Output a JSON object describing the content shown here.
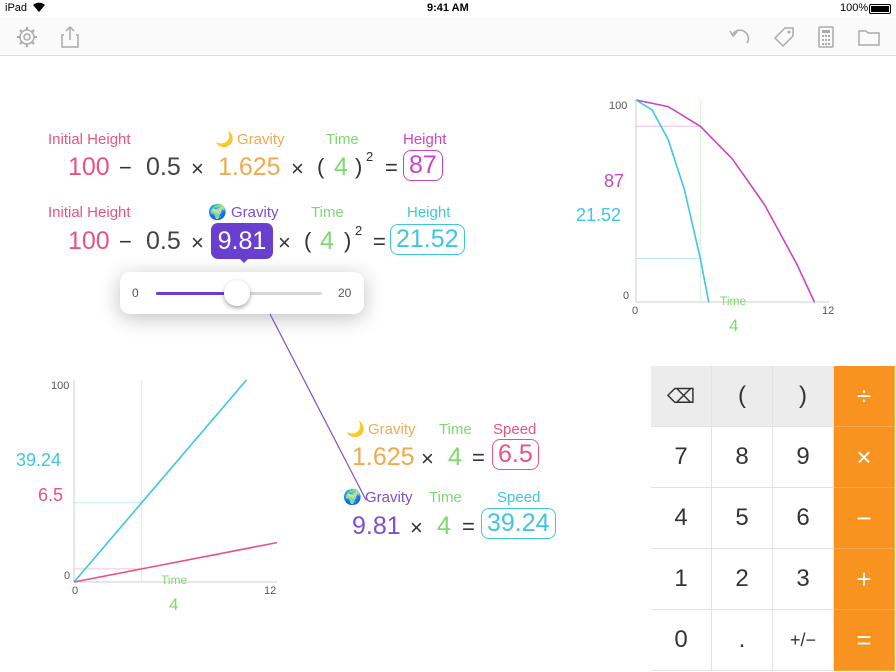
{
  "status": {
    "device": "iPad",
    "time": "9:41 AM",
    "battery": "100%"
  },
  "toolbar": {
    "left_icons": [
      "gear-icon",
      "share-icon"
    ],
    "right_icons": [
      "undo-icon",
      "tag-icon",
      "calculator-icon",
      "folder-icon"
    ]
  },
  "eq1": {
    "initial_height_label": "Initial Height",
    "initial_height": "100",
    "minus": "−",
    "half": "0.5",
    "times": "×",
    "gravity_label": "Gravity",
    "gravity_icon": "🌙",
    "gravity": "1.625",
    "time_label": "Time",
    "time": "4",
    "open_paren": "(",
    "close_paren": ")",
    "exponent": "2",
    "equals": "=",
    "height_label": "Height",
    "height": "87"
  },
  "eq2": {
    "initial_height_label": "Initial Height",
    "initial_height": "100",
    "minus": "−",
    "half": "0.5",
    "times": "×",
    "gravity_label": "Gravity",
    "gravity_icon": "🌍",
    "gravity": "9.81",
    "time_label": "Time",
    "time": "4",
    "open_paren": "(",
    "close_paren": ")",
    "exponent": "2",
    "equals": "=",
    "height_label": "Height",
    "height": "21.52"
  },
  "slider": {
    "min_label": "0",
    "max_label": "20",
    "value": 9.81,
    "min": 0,
    "max": 20
  },
  "eq3": {
    "gravity_label": "Gravity",
    "gravity_icon": "🌙",
    "gravity": "1.625",
    "times": "×",
    "time_label": "Time",
    "time": "4",
    "equals": "=",
    "speed_label": "Speed",
    "speed": "6.5"
  },
  "eq4": {
    "gravity_label": "Gravity",
    "gravity_icon": "🌍",
    "gravity": "9.81",
    "times": "×",
    "time_label": "Time",
    "time": "4",
    "equals": "=",
    "speed_label": "Speed",
    "speed": "39.24"
  },
  "chart_height": {
    "y_top_tick": "100",
    "y_zero_tick": "0",
    "x_zero_tick": "0",
    "x_max_tick": "12",
    "value_label_1": "87",
    "value_label_2": "21.52",
    "x_label": "Time",
    "x_value": "4"
  },
  "chart_speed": {
    "y_top_tick": "100",
    "y_zero_tick": "0",
    "x_zero_tick": "0",
    "x_max_tick": "12",
    "value_label_1": "39.24",
    "value_label_2": "6.5",
    "x_label": "Time",
    "x_value": "4"
  },
  "chart_data": [
    {
      "type": "line",
      "xlabel": "Time",
      "x_marker": 4,
      "xlim": [
        0,
        12
      ],
      "ylim": [
        0,
        100
      ],
      "series": [
        {
          "color": "#cc44c4",
          "values": [
            [
              0,
              100
            ],
            [
              2,
              96.75
            ],
            [
              4,
              87
            ],
            [
              6,
              70.75
            ],
            [
              8,
              48
            ],
            [
              10,
              18.75
            ],
            [
              11.09,
              0
            ]
          ]
        },
        {
          "color": "#3fc6e0",
          "values": [
            [
              0,
              100
            ],
            [
              1,
              95.1
            ],
            [
              2,
              80.38
            ],
            [
              3,
              55.86
            ],
            [
              4,
              21.52
            ],
            [
              4.52,
              0
            ]
          ]
        }
      ]
    },
    {
      "type": "line",
      "xlabel": "Time",
      "x_marker": 4,
      "xlim": [
        0,
        12
      ],
      "ylim": [
        0,
        100
      ],
      "series": [
        {
          "color": "#3fc6e0",
          "values": [
            [
              0,
              0
            ],
            [
              4,
              39.24
            ],
            [
              10.19,
              100
            ]
          ]
        },
        {
          "color": "#e8547e",
          "values": [
            [
              0,
              0
            ],
            [
              4,
              6.5
            ],
            [
              12,
              19.5
            ]
          ]
        }
      ]
    }
  ],
  "keypad": {
    "rows": [
      [
        "⌫",
        "(",
        ")",
        "÷"
      ],
      [
        "7",
        "8",
        "9",
        "×"
      ],
      [
        "4",
        "5",
        "6",
        "−"
      ],
      [
        "1",
        "2",
        "3",
        "+"
      ],
      [
        "0",
        ".",
        "+/−",
        "="
      ]
    ]
  }
}
